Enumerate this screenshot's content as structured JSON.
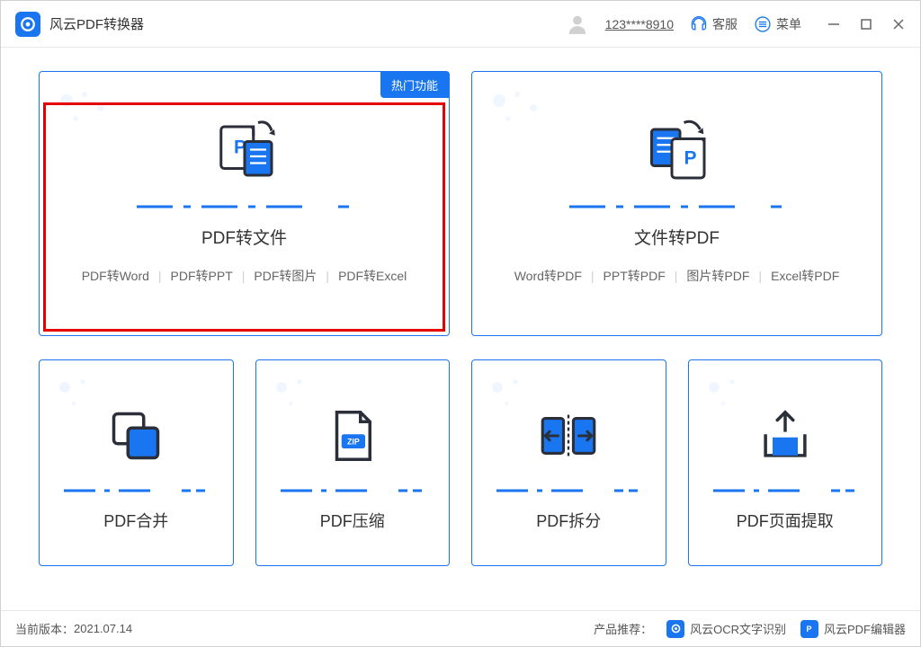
{
  "header": {
    "title": "风云PDF转换器",
    "user_id": "123****8910",
    "support": "客服",
    "menu": "菜单"
  },
  "cards": {
    "hot_badge": "热门功能",
    "pdf_to_file": {
      "title": "PDF转文件",
      "opts": [
        "PDF转Word",
        "PDF转PPT",
        "PDF转图片",
        "PDF转Excel"
      ]
    },
    "file_to_pdf": {
      "title": "文件转PDF",
      "opts": [
        "Word转PDF",
        "PPT转PDF",
        "图片转PDF",
        "Excel转PDF"
      ]
    },
    "merge": "PDF合并",
    "compress": "PDF压缩",
    "split": "PDF拆分",
    "extract": "PDF页面提取",
    "zip_label": "ZIP"
  },
  "footer": {
    "version_label": "当前版本：",
    "version": "2021.07.14",
    "recommend_label": "产品推荐：",
    "ocr": "风云OCR文字识别",
    "editor": "风云PDF编辑器"
  }
}
